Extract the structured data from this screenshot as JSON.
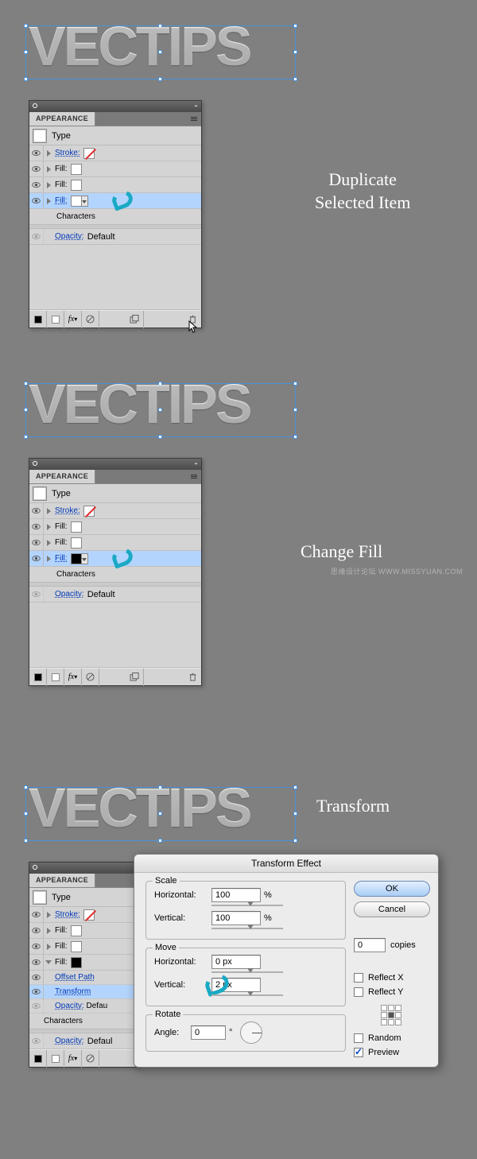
{
  "logo_text": "VECTIPS",
  "captions": {
    "s1a": "Duplicate",
    "s1b": "Selected Item",
    "s2": "Change Fill",
    "s3": "Transform"
  },
  "watermark": "思缘设计论坛  WWW.MISSYUAN.COM",
  "appearance": {
    "title": "APPEARANCE",
    "type_label": "Type",
    "rows": {
      "stroke": "Stroke:",
      "fill": "Fill:",
      "characters": "Characters",
      "opacity": "Opacity:",
      "default": "Default",
      "offset_path": "Offset Path",
      "transform": "Transform"
    },
    "footer": {
      "fx": "fx"
    }
  },
  "dialog": {
    "title": "Transform Effect",
    "scale": {
      "legend": "Scale",
      "horizontal_label": "Horizontal:",
      "horizontal_value": "100",
      "vertical_label": "Vertical:",
      "vertical_value": "100",
      "unit": "%"
    },
    "move": {
      "legend": "Move",
      "horizontal_label": "Horizontal:",
      "horizontal_value": "0 px",
      "vertical_label": "Vertical:",
      "vertical_value": "2 px"
    },
    "rotate": {
      "legend": "Rotate",
      "angle_label": "Angle:",
      "angle_value": "0",
      "unit": "°"
    },
    "buttons": {
      "ok": "OK",
      "cancel": "Cancel"
    },
    "copies_label": "copies",
    "copies_value": "0",
    "reflect_x": "Reflect X",
    "reflect_y": "Reflect Y",
    "random": "Random",
    "preview": "Preview"
  }
}
